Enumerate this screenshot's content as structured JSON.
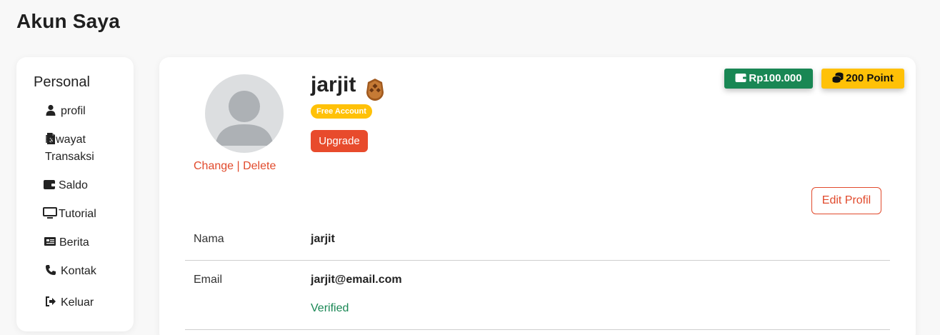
{
  "page": {
    "title": "Akun Saya"
  },
  "sidebar": {
    "heading": "Personal",
    "items": [
      {
        "label": "profil",
        "icon": "user-icon"
      },
      {
        "label": "Riwayat Transaksi",
        "icon": "invoice-icon"
      },
      {
        "label": "Saldo",
        "icon": "wallet-icon"
      },
      {
        "label": "Tutorial",
        "icon": "monitor-icon"
      },
      {
        "label": "Berita",
        "icon": "newspaper-icon"
      },
      {
        "label": "Kontak",
        "icon": "phone-icon"
      },
      {
        "label": "Keluar",
        "icon": "sign-out-icon"
      }
    ]
  },
  "profile": {
    "username": "jarjit",
    "account_type": "Free Account",
    "upgrade_label": "Upgrade",
    "avatar_change": "Change",
    "avatar_separator": " | ",
    "avatar_delete": "Delete",
    "edit_label": "Edit Profil"
  },
  "badges": {
    "saldo": "Rp100.000",
    "point": "200 Point"
  },
  "info": {
    "name_label": "Nama",
    "name_value": "jarjit",
    "email_label": "Email",
    "email_value": "jarjit@email.com",
    "email_status": "Verified"
  },
  "colors": {
    "accent": "#e14a2c",
    "success": "#198754",
    "warning": "#ffc107"
  }
}
